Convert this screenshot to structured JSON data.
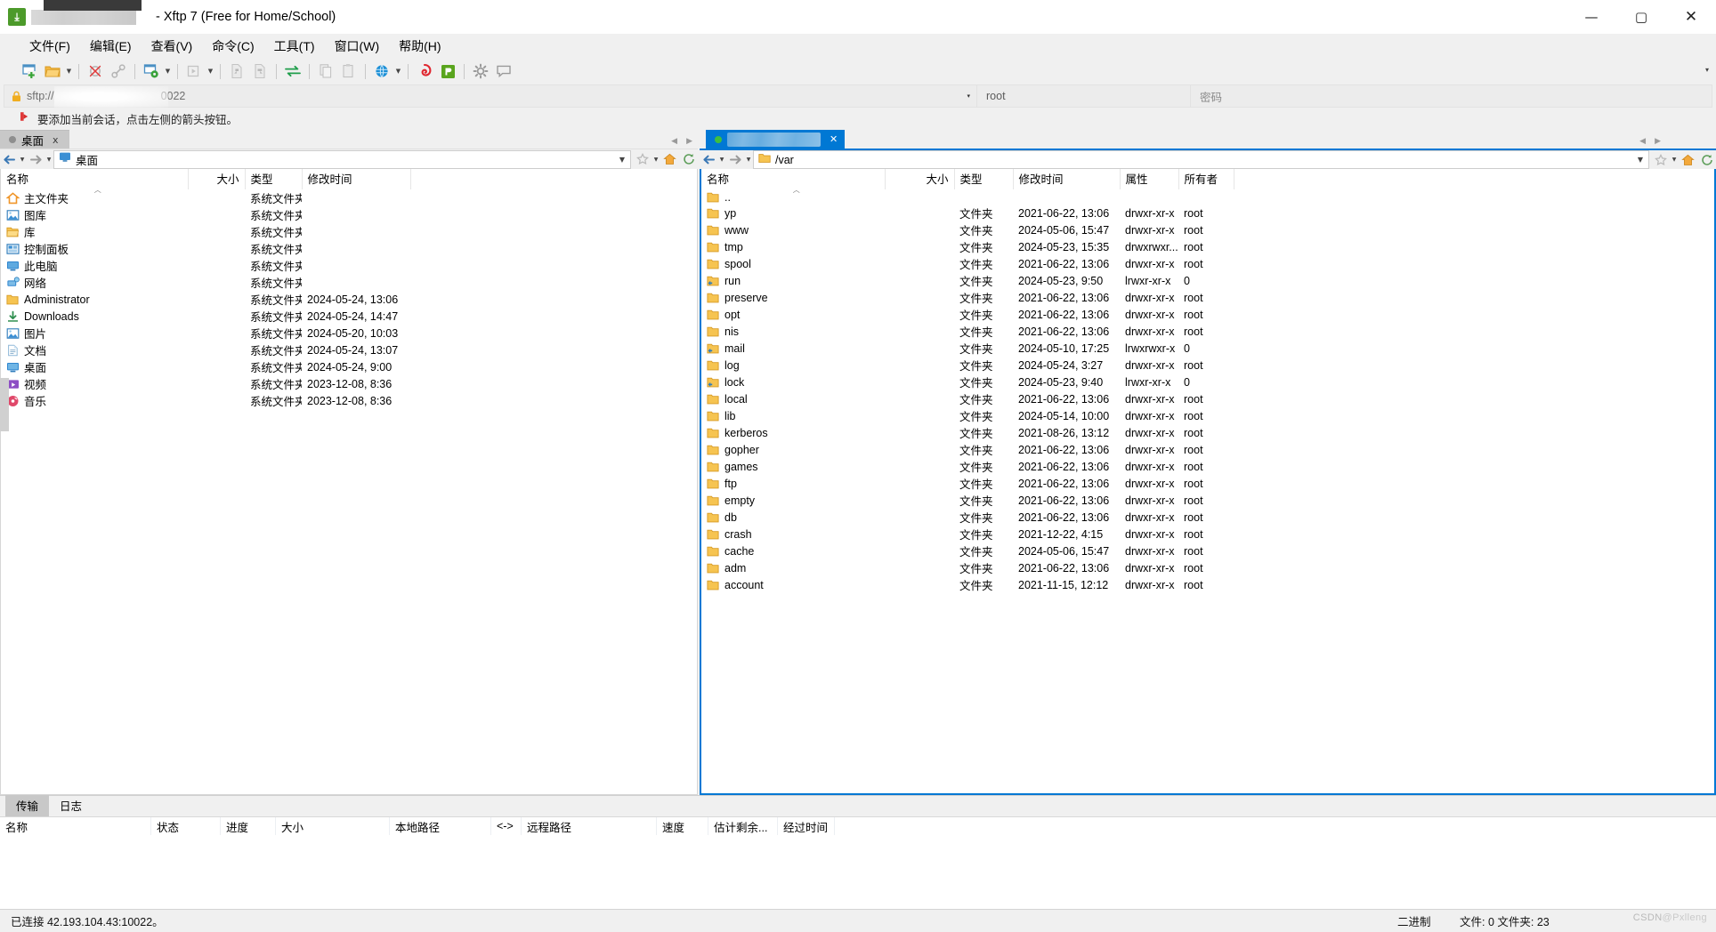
{
  "window": {
    "title_suffix": "- Xftp 7 (Free for Home/School)",
    "app_icon": "xftp-icon",
    "minimize": "—",
    "maximize": "▢",
    "close": "✕"
  },
  "menubar": {
    "items": [
      {
        "label": "文件(F)",
        "key": "F"
      },
      {
        "label": "编辑(E)",
        "key": "E"
      },
      {
        "label": "查看(V)",
        "key": "V"
      },
      {
        "label": "命令(C)",
        "key": "C"
      },
      {
        "label": "工具(T)",
        "key": "T"
      },
      {
        "label": "窗口(W)",
        "key": "W"
      },
      {
        "label": "帮助(H)",
        "key": "H"
      }
    ]
  },
  "toolbar": {
    "overflow": "▾",
    "buttons": [
      {
        "name": "new-session-icon"
      },
      {
        "name": "open-folder-icon"
      },
      {
        "name": "open-folder-dropdown-caret"
      },
      {
        "name": "separator"
      },
      {
        "name": "disconnect-icon"
      },
      {
        "name": "link-icon"
      },
      {
        "name": "separator"
      },
      {
        "name": "session-properties-icon"
      },
      {
        "name": "session-properties-caret"
      },
      {
        "name": "separator"
      },
      {
        "name": "transfer-start-icon"
      },
      {
        "name": "transfer-start-caret"
      },
      {
        "name": "separator"
      },
      {
        "name": "upload-icon"
      },
      {
        "name": "download-icon"
      },
      {
        "name": "separator"
      },
      {
        "name": "sync-browsing-icon"
      },
      {
        "name": "separator"
      },
      {
        "name": "copy-icon"
      },
      {
        "name": "paste-icon"
      },
      {
        "name": "separator"
      },
      {
        "name": "globe-icon"
      },
      {
        "name": "globe-caret"
      },
      {
        "name": "separator"
      },
      {
        "name": "xshell-icon"
      },
      {
        "name": "xftp-icon"
      },
      {
        "name": "separator"
      },
      {
        "name": "settings-gear-icon"
      },
      {
        "name": "comment-icon"
      }
    ]
  },
  "address": {
    "url": "sftp://",
    "url_tail": "0022",
    "user": "root",
    "password_placeholder": "密码",
    "dropdown_caret": "▾",
    "lock_icon": "lock-icon"
  },
  "notice": {
    "text": "要添加当前会话，点击左侧的箭头按钮。",
    "icon": "red-arrow-icon"
  },
  "local_panel": {
    "tab": {
      "label": "桌面",
      "close": "x"
    },
    "path": "桌面",
    "nav_back": "←",
    "nav_forward": "→",
    "columns": [
      "名称",
      "大小",
      "类型",
      "修改时间"
    ],
    "rows": [
      {
        "icon": "home-folder-icon",
        "name": "主文件夹",
        "size": "",
        "type": "系统文件夹",
        "modified": ""
      },
      {
        "icon": "gallery-icon",
        "name": "图库",
        "size": "",
        "type": "系统文件夹",
        "modified": ""
      },
      {
        "icon": "library-folder-icon",
        "name": "库",
        "size": "",
        "type": "系统文件夹",
        "modified": ""
      },
      {
        "icon": "control-panel-icon",
        "name": "控制面板",
        "size": "",
        "type": "系统文件夹",
        "modified": ""
      },
      {
        "icon": "this-pc-icon",
        "name": "此电脑",
        "size": "",
        "type": "系统文件夹",
        "modified": ""
      },
      {
        "icon": "network-icon",
        "name": "网络",
        "size": "",
        "type": "系统文件夹",
        "modified": ""
      },
      {
        "icon": "folder-icon",
        "name": "Administrator",
        "size": "",
        "type": "系统文件夹",
        "modified": "2024-05-24, 13:06"
      },
      {
        "icon": "downloads-icon",
        "name": "Downloads",
        "size": "",
        "type": "系统文件夹",
        "modified": "2024-05-24, 14:47"
      },
      {
        "icon": "pictures-icon",
        "name": "图片",
        "size": "",
        "type": "系统文件夹",
        "modified": "2024-05-20, 10:03"
      },
      {
        "icon": "documents-icon",
        "name": "文档",
        "size": "",
        "type": "系统文件夹",
        "modified": "2024-05-24, 13:07"
      },
      {
        "icon": "desktop-icon",
        "name": "桌面",
        "size": "",
        "type": "系统文件夹",
        "modified": "2024-05-24, 9:00"
      },
      {
        "icon": "videos-icon",
        "name": "视频",
        "size": "",
        "type": "系统文件夹",
        "modified": "2023-12-08, 8:36"
      },
      {
        "icon": "music-icon",
        "name": "音乐",
        "size": "",
        "type": "系统文件夹",
        "modified": "2023-12-08, 8:36"
      }
    ]
  },
  "remote_panel": {
    "tab": {
      "close": "✕",
      "status": "connected"
    },
    "path": "/var",
    "nav_back": "←",
    "nav_forward": "→",
    "columns": [
      "名称",
      "大小",
      "类型",
      "修改时间",
      "属性",
      "所有者"
    ],
    "rows": [
      {
        "icon": "folder-up-icon",
        "name": "..",
        "size": "",
        "type": "",
        "modified": "",
        "perm": "",
        "owner": ""
      },
      {
        "icon": "folder-icon",
        "name": "yp",
        "size": "",
        "type": "文件夹",
        "modified": "2021-06-22, 13:06",
        "perm": "drwxr-xr-x",
        "owner": "root"
      },
      {
        "icon": "folder-icon",
        "name": "www",
        "size": "",
        "type": "文件夹",
        "modified": "2024-05-06, 15:47",
        "perm": "drwxr-xr-x",
        "owner": "root"
      },
      {
        "icon": "folder-icon",
        "name": "tmp",
        "size": "",
        "type": "文件夹",
        "modified": "2024-05-23, 15:35",
        "perm": "drwxrwxr...",
        "owner": "root"
      },
      {
        "icon": "folder-icon",
        "name": "spool",
        "size": "",
        "type": "文件夹",
        "modified": "2021-06-22, 13:06",
        "perm": "drwxr-xr-x",
        "owner": "root"
      },
      {
        "icon": "folder-link-icon",
        "name": "run",
        "size": "",
        "type": "文件夹",
        "modified": "2024-05-23, 9:50",
        "perm": "lrwxr-xr-x",
        "owner": "0"
      },
      {
        "icon": "folder-icon",
        "name": "preserve",
        "size": "",
        "type": "文件夹",
        "modified": "2021-06-22, 13:06",
        "perm": "drwxr-xr-x",
        "owner": "root"
      },
      {
        "icon": "folder-icon",
        "name": "opt",
        "size": "",
        "type": "文件夹",
        "modified": "2021-06-22, 13:06",
        "perm": "drwxr-xr-x",
        "owner": "root"
      },
      {
        "icon": "folder-icon",
        "name": "nis",
        "size": "",
        "type": "文件夹",
        "modified": "2021-06-22, 13:06",
        "perm": "drwxr-xr-x",
        "owner": "root"
      },
      {
        "icon": "folder-link-icon",
        "name": "mail",
        "size": "",
        "type": "文件夹",
        "modified": "2024-05-10, 17:25",
        "perm": "lrwxrwxr-x",
        "owner": "0"
      },
      {
        "icon": "folder-icon",
        "name": "log",
        "size": "",
        "type": "文件夹",
        "modified": "2024-05-24, 3:27",
        "perm": "drwxr-xr-x",
        "owner": "root"
      },
      {
        "icon": "folder-link-icon",
        "name": "lock",
        "size": "",
        "type": "文件夹",
        "modified": "2024-05-23, 9:40",
        "perm": "lrwxr-xr-x",
        "owner": "0"
      },
      {
        "icon": "folder-icon",
        "name": "local",
        "size": "",
        "type": "文件夹",
        "modified": "2021-06-22, 13:06",
        "perm": "drwxr-xr-x",
        "owner": "root"
      },
      {
        "icon": "folder-icon",
        "name": "lib",
        "size": "",
        "type": "文件夹",
        "modified": "2024-05-14, 10:00",
        "perm": "drwxr-xr-x",
        "owner": "root"
      },
      {
        "icon": "folder-icon",
        "name": "kerberos",
        "size": "",
        "type": "文件夹",
        "modified": "2021-08-26, 13:12",
        "perm": "drwxr-xr-x",
        "owner": "root"
      },
      {
        "icon": "folder-icon",
        "name": "gopher",
        "size": "",
        "type": "文件夹",
        "modified": "2021-06-22, 13:06",
        "perm": "drwxr-xr-x",
        "owner": "root"
      },
      {
        "icon": "folder-icon",
        "name": "games",
        "size": "",
        "type": "文件夹",
        "modified": "2021-06-22, 13:06",
        "perm": "drwxr-xr-x",
        "owner": "root"
      },
      {
        "icon": "folder-icon",
        "name": "ftp",
        "size": "",
        "type": "文件夹",
        "modified": "2021-06-22, 13:06",
        "perm": "drwxr-xr-x",
        "owner": "root"
      },
      {
        "icon": "folder-icon",
        "name": "empty",
        "size": "",
        "type": "文件夹",
        "modified": "2021-06-22, 13:06",
        "perm": "drwxr-xr-x",
        "owner": "root"
      },
      {
        "icon": "folder-icon",
        "name": "db",
        "size": "",
        "type": "文件夹",
        "modified": "2021-06-22, 13:06",
        "perm": "drwxr-xr-x",
        "owner": "root"
      },
      {
        "icon": "folder-icon",
        "name": "crash",
        "size": "",
        "type": "文件夹",
        "modified": "2021-12-22, 4:15",
        "perm": "drwxr-xr-x",
        "owner": "root"
      },
      {
        "icon": "folder-icon",
        "name": "cache",
        "size": "",
        "type": "文件夹",
        "modified": "2024-05-06, 15:47",
        "perm": "drwxr-xr-x",
        "owner": "root"
      },
      {
        "icon": "folder-icon",
        "name": "adm",
        "size": "",
        "type": "文件夹",
        "modified": "2021-06-22, 13:06",
        "perm": "drwxr-xr-x",
        "owner": "root"
      },
      {
        "icon": "folder-icon",
        "name": "account",
        "size": "",
        "type": "文件夹",
        "modified": "2021-11-15, 12:12",
        "perm": "drwxr-xr-x",
        "owner": "root"
      }
    ]
  },
  "transfer_panel": {
    "tabs": [
      {
        "label": "传输",
        "active": true
      },
      {
        "label": "日志",
        "active": false
      }
    ],
    "columns": [
      "名称",
      "状态",
      "进度",
      "大小",
      "本地路径",
      "<->",
      "远程路径",
      "速度",
      "估计剩余...",
      "经过时间"
    ]
  },
  "statusbar": {
    "connection": "已连接 42.193.104.43:10022。",
    "mode": "二进制",
    "counts": "文件: 0  文件夹: 23",
    "watermark_prefix": "CSDN",
    "watermark_suffix": "@Pxlleng"
  }
}
